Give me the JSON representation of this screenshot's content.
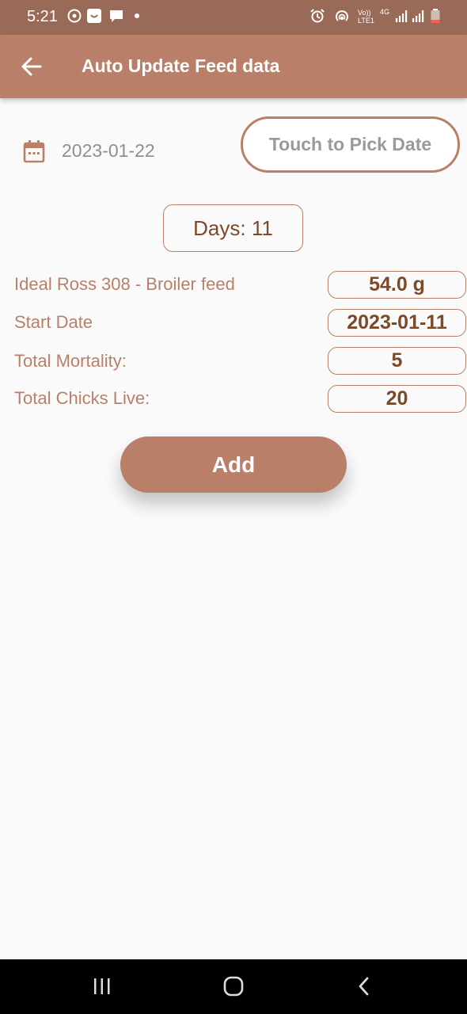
{
  "status_bar": {
    "time": "5:21",
    "volte_label": "Vo)) LTE1",
    "network_label": "4G",
    "icons": [
      "whatsapp-icon",
      "smile-icon",
      "message-icon",
      "dot-icon",
      "alarm-icon",
      "hotspot-icon",
      "signal-icon",
      "signal-icon",
      "battery-icon"
    ]
  },
  "app_bar": {
    "title": "Auto Update Feed data",
    "back_icon": "arrow-left-icon"
  },
  "date_picker": {
    "icon": "calendar-icon",
    "selected_date": "2023-01-22",
    "pick_button_label": "Touch to Pick Date"
  },
  "days_label": "Days: 11",
  "info": [
    {
      "label": "Ideal Ross 308 - Broiler feed",
      "value": "54.0 g"
    },
    {
      "label": "Start Date",
      "value": "2023-01-11"
    },
    {
      "label": "Total Mortality:",
      "value": "5"
    },
    {
      "label": "Total Chicks Live:",
      "value": "20"
    }
  ],
  "add_button_label": "Add",
  "nav_bar": {
    "icons": [
      "recent-apps-icon",
      "home-icon",
      "back-icon"
    ]
  },
  "colors": {
    "accent": "#b97f68",
    "status_bar": "#9a6a58",
    "value_text": "#7a4a2a",
    "background": "#fafafa"
  }
}
